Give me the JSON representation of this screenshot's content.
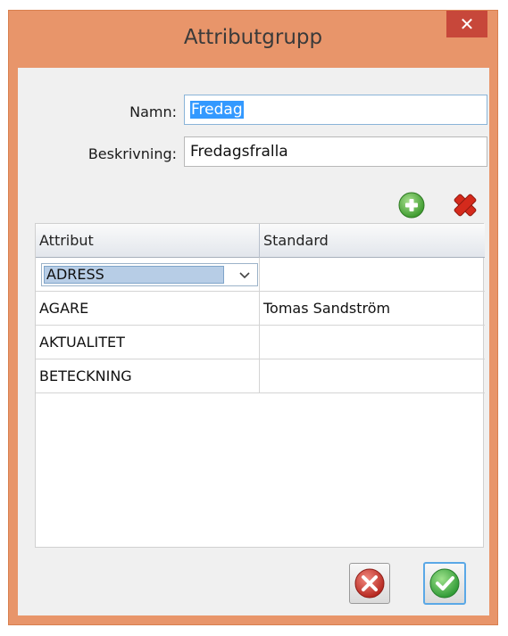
{
  "window": {
    "title": "Attributgrupp",
    "close_glyph": "✕"
  },
  "form": {
    "name_label": "Namn:",
    "name_value": "Fredag",
    "description_label": "Beskrivning:",
    "description_value": "Fredagsfralla"
  },
  "toolbar": {
    "add_icon": "plus-circle-icon",
    "delete_icon": "red-x-icon"
  },
  "grid": {
    "columns": [
      "Attribut",
      "Standard"
    ],
    "rows": [
      {
        "attribut": "ADRESS",
        "standard": ""
      },
      {
        "attribut": "AGARE",
        "standard": "Tomas Sandström"
      },
      {
        "attribut": "AKTUALITET",
        "standard": ""
      },
      {
        "attribut": "BETECKNING",
        "standard": ""
      }
    ]
  },
  "footer": {
    "cancel_icon": "cancel-circle-icon",
    "ok_icon": "ok-check-icon"
  },
  "colors": {
    "frame": "#e8956a",
    "close": "#c7473a",
    "selection": "#3399ff",
    "ok": "#3fae4a",
    "cancel": "#c93b34"
  }
}
